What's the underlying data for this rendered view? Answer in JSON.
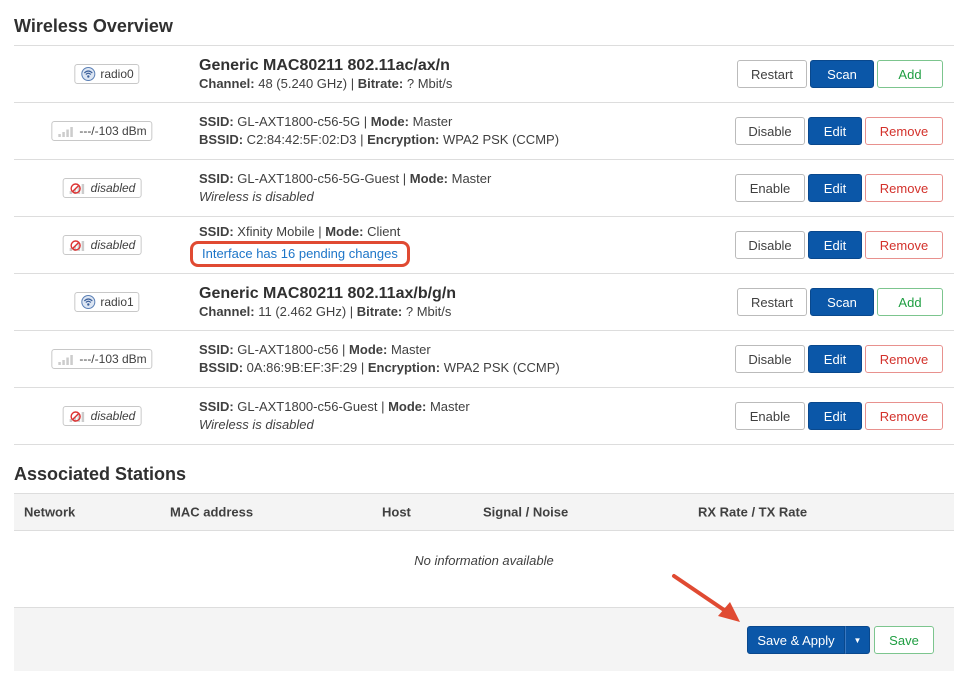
{
  "wireless": {
    "title": "Wireless Overview",
    "rows": [
      {
        "badge": "radio0",
        "title": "Generic MAC80211 802.11ac/ax/n",
        "l2": {
          "k1": "Channel:",
          "v1": " 48 (5.240 GHz) | ",
          "k2": "Bitrate:",
          "v2": " ? Mbit/s"
        },
        "buttons": [
          "Restart",
          "Scan",
          "Add"
        ]
      },
      {
        "badge": "---/-103 dBm",
        "l1": {
          "k1": "SSID:",
          "v1": " GL-AXT1800-c56-5G | ",
          "k2": "Mode:",
          "v2": " Master"
        },
        "l2": {
          "k1": "BSSID:",
          "v1": " C2:84:42:5F:02:D3 | ",
          "k2": "Encryption:",
          "v2": " WPA2 PSK (CCMP)"
        },
        "buttons": [
          "Disable",
          "Edit",
          "Remove"
        ]
      },
      {
        "badge": "disabled",
        "l1": {
          "k1": "SSID:",
          "v1": " GL-AXT1800-c56-5G-Guest | ",
          "k2": "Mode:",
          "v2": " Master"
        },
        "l2text": "Wireless is disabled",
        "buttons": [
          "Enable",
          "Edit",
          "Remove"
        ]
      },
      {
        "badge": "disabled",
        "l1": {
          "k1": "SSID:",
          "v1": " Xfinity Mobile | ",
          "k2": "Mode:",
          "v2": " Client"
        },
        "l2link": "Interface has 16 pending changes",
        "buttons": [
          "Disable",
          "Edit",
          "Remove"
        ]
      },
      {
        "badge": "radio1",
        "title": "Generic MAC80211 802.11ax/b/g/n",
        "l2": {
          "k1": "Channel:",
          "v1": " 11 (2.462 GHz) | ",
          "k2": "Bitrate:",
          "v2": " ? Mbit/s"
        },
        "buttons": [
          "Restart",
          "Scan",
          "Add"
        ]
      },
      {
        "badge": "---/-103 dBm",
        "l1": {
          "k1": "SSID:",
          "v1": " GL-AXT1800-c56 | ",
          "k2": "Mode:",
          "v2": " Master"
        },
        "l2": {
          "k1": "BSSID:",
          "v1": " 0A:86:9B:EF:3F:29 | ",
          "k2": "Encryption:",
          "v2": " WPA2 PSK (CCMP)"
        },
        "buttons": [
          "Disable",
          "Edit",
          "Remove"
        ]
      },
      {
        "badge": "disabled",
        "l1": {
          "k1": "SSID:",
          "v1": " GL-AXT1800-c56-Guest | ",
          "k2": "Mode:",
          "v2": " Master"
        },
        "l2text": "Wireless is disabled",
        "buttons": [
          "Enable",
          "Edit",
          "Remove"
        ]
      }
    ]
  },
  "stations": {
    "title": "Associated Stations",
    "columns": [
      "Network",
      "MAC address",
      "Host",
      "Signal / Noise",
      "RX Rate / TX Rate"
    ],
    "empty": "No information available"
  },
  "footer": {
    "save_apply": "Save & Apply",
    "save": "Save"
  },
  "colors": {
    "primary": "#0b57a8",
    "positive": "#1f9e42",
    "negative": "#d3312b",
    "highlight": "#e04a32"
  }
}
